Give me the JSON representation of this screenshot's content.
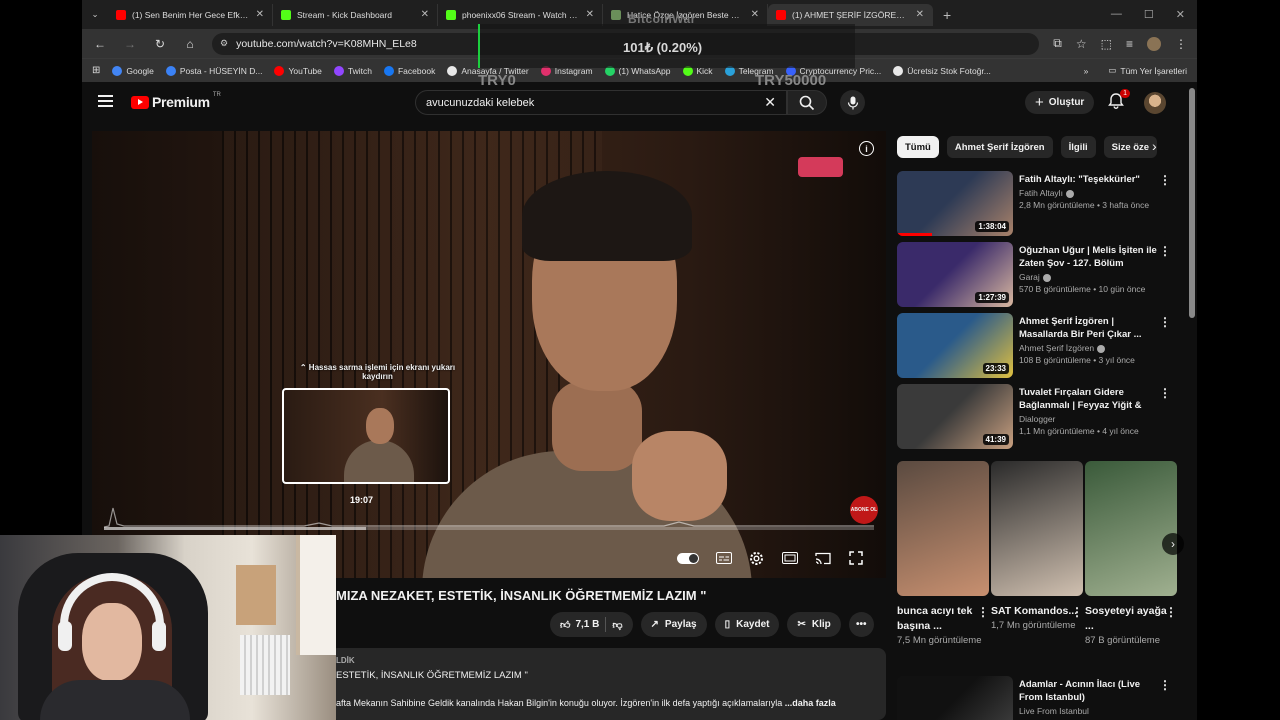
{
  "browser": {
    "tabs": [
      {
        "title": "(1) Sen Benim Her Gece Efkarım",
        "favicon_color": "#ff0000",
        "active": false
      },
      {
        "title": "Stream - Kick Dashboard",
        "favicon_color": "#53fc18",
        "active": false
      },
      {
        "title": "phoenixx06 Stream - Watch Live",
        "favicon_color": "#53fc18",
        "active": false
      },
      {
        "title": "Hatice Özge İzgören Beste Kimde",
        "favicon_color": "#6a8f5a",
        "active": false
      },
      {
        "title": "(1) AHMET ŞERİF İZGÖREN \" Ç",
        "favicon_color": "#ff0000",
        "active": true
      }
    ],
    "new_tab_symbol": "+",
    "url": "youtube.com/watch?v=K08MHN_ELe8",
    "bookmarks": [
      {
        "label": "Google",
        "color": "#4285f4"
      },
      {
        "label": "Posta - HÜSEYİN D...",
        "color": "#3b82f6"
      },
      {
        "label": "YouTube",
        "color": "#ff0000"
      },
      {
        "label": "Twitch",
        "color": "#9146ff"
      },
      {
        "label": "Facebook",
        "color": "#1877f2"
      },
      {
        "label": "Anasayfa / Twitter",
        "color": "#e8e8e8"
      },
      {
        "label": "Instagram",
        "color": "#e1306c"
      },
      {
        "label": "(1) WhatsApp",
        "color": "#25d366"
      },
      {
        "label": "Kick",
        "color": "#53fc18"
      },
      {
        "label": "Telegram",
        "color": "#2aa1da"
      },
      {
        "label": "Cryptocurrency Pric...",
        "color": "#3861fb"
      },
      {
        "label": "Ücretsiz Stok Fotoğr...",
        "color": "#e8e8e8"
      }
    ],
    "bookmarks_more": "»",
    "all_bookmarks": "Tüm Yer İşaretleri"
  },
  "overlay": {
    "title": "BitcoinWar",
    "price": "101₺ (0.20%)",
    "left_label": "TRY0",
    "right_label": "TRY50000",
    "accent_color": "#1ccf3e"
  },
  "yt": {
    "logo_text": "Premium",
    "logo_region": "TR",
    "search_value": "avucunuzdaki kelebek",
    "create_label": "Oluştur",
    "notification_count": "1"
  },
  "player": {
    "seek_hint": "⌃ Hassas sarma işlemi için ekranı yukarı kaydırın",
    "preview_time": "19:07",
    "watermark_subscribe": "ABONE OL",
    "progress_played_fraction": 0.0,
    "hover_fraction": 0.34,
    "accent": "#ff0000"
  },
  "video": {
    "title": "MIZA NEZAKET, ESTETİK, İNSANLIK ÖĞRETMEMİZ LAZIM \"",
    "like_count": "7,1 B",
    "share_label": "Paylaş",
    "save_label": "Kaydet",
    "clip_label": "Klip",
    "desc_line1": "LDİK",
    "desc_line2": "ESTETİK, İNSANLIK ÖĞRETMEMİZ LAZIM \"",
    "desc_line3": "afta Mekanın Sahibine Geldik kanalında Hakan Bilgin'in konuğu oluyor. İzgören'in ilk defa yaptığı açıklamalarıyla",
    "desc_more": "...daha fazla"
  },
  "sidebar": {
    "chips": [
      "Tümü",
      "Ahmet Şerif İzgören",
      "İlgili",
      "Size öze"
    ],
    "recommendations": [
      {
        "title": "Fatih Altaylı: \"Teşekkürler\"",
        "channel": "Fatih Altaylı",
        "verified": true,
        "stats": "2,8 Mn görüntüleme • 3 hafta önce",
        "duration": "1:38:04",
        "watched_fraction": 0.3,
        "thumb_colors": [
          "#2d3a55",
          "#a9826a"
        ]
      },
      {
        "title": "Oğuzhan Uğur | Melis İşiten ile Zaten Şov - 127. Bölüm",
        "channel": "Garaj",
        "verified": true,
        "stats": "570 B görüntüleme • 10 gün önce",
        "duration": "1:27:39",
        "watched_fraction": 0.0,
        "thumb_colors": [
          "#3a2a6a",
          "#d9b8a0"
        ]
      },
      {
        "title": "Ahmet Şerif İzgören | Masallarda Bir Peri Çıkar ...",
        "channel": "Ahmet Şerif İzgören",
        "verified": true,
        "stats": "108 B görüntüleme • 3 yıl önce",
        "duration": "23:33",
        "watched_fraction": 0.0,
        "thumb_colors": [
          "#2a5a8a",
          "#e0c040"
        ]
      },
      {
        "title": "Tuvalet Fırçaları Gidere Bağlanmalı | Feyyaz Yiğit & Ce...",
        "channel": "Dialogger",
        "verified": false,
        "stats": "1,1 Mn görüntüleme • 4 yıl önce",
        "duration": "41:39",
        "watched_fraction": 0.0,
        "thumb_colors": [
          "#3a3a3a",
          "#c9a080"
        ]
      },
      {
        "title": "Adamlar - Acının İlacı (Live From Istanbul)",
        "channel": "Live From Istanbul",
        "verified": false,
        "stats": "",
        "duration": "",
        "watched_fraction": 0.0,
        "thumb_colors": [
          "#111111",
          "#444444"
        ]
      }
    ],
    "shorts": [
      {
        "title": "bunca acıyı tek başına ...",
        "views": "7,5 Mn görüntüleme",
        "thumb_colors": [
          "#5a4a40",
          "#c89070"
        ]
      },
      {
        "title": "SAT Komandos...",
        "views": "1,7 Mn görüntüleme",
        "thumb_colors": [
          "#2a2a2a",
          "#d0c0b0"
        ]
      },
      {
        "title": "Sosyeteyi ayağa ...",
        "views": "87 B görüntüleme",
        "thumb_colors": [
          "#3a5a3a",
          "#a0b090"
        ]
      }
    ]
  }
}
